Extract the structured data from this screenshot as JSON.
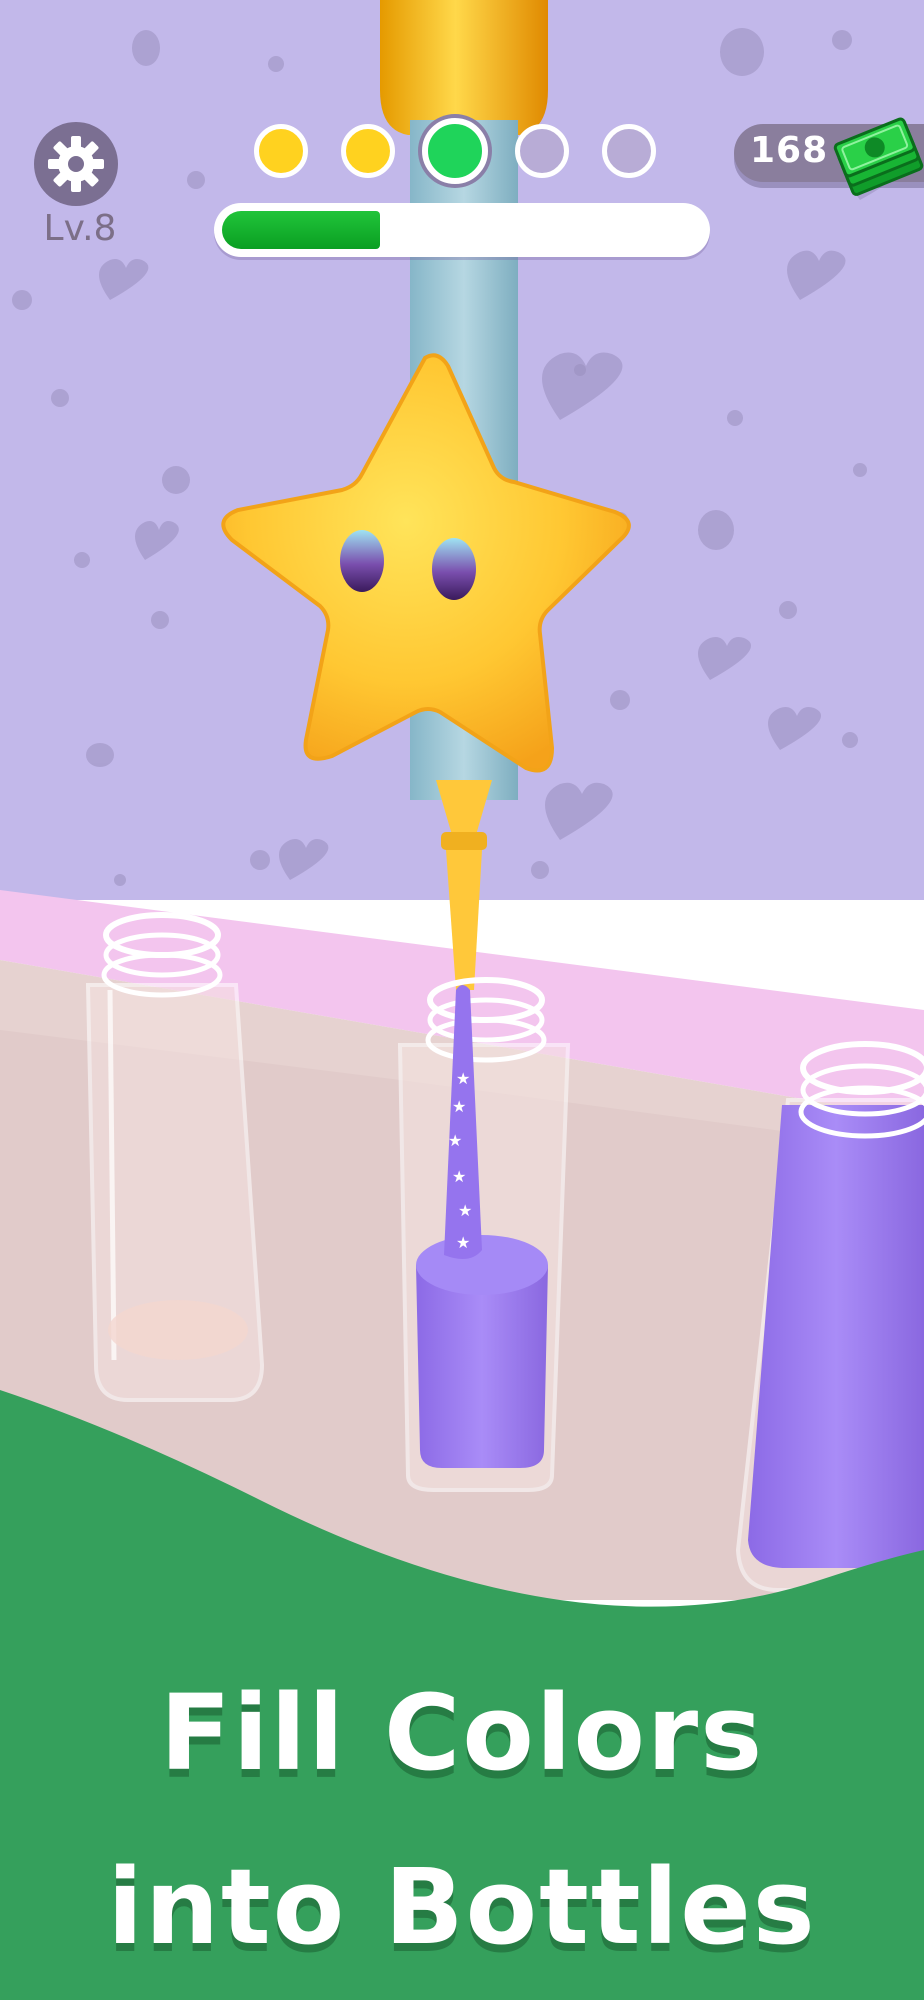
{
  "colors": {
    "wall": "#c2b8ea",
    "wall_spots": "#9a8fbd",
    "shelf_pink": "#f3c5ee",
    "table": "#e6d2d0",
    "hill_green": "#35a05c",
    "sand_purple": "#9a7af0",
    "star_yellow": "#ffc93a",
    "progress_green": "#17b02f",
    "dot_yellow": "#ffd21f",
    "dot_green": "#1fd45a"
  },
  "hud": {
    "settings_icon": "gear-icon",
    "level": "Lv.8",
    "stage_dots": [
      {
        "state": "done",
        "color": "#ffd21f"
      },
      {
        "state": "done",
        "color": "#ffd21f"
      },
      {
        "state": "current",
        "color": "#1fd45a"
      },
      {
        "state": "pending",
        "color": "#b8acd6"
      },
      {
        "state": "pending",
        "color": "#b8acd6"
      }
    ],
    "progress": 0.33,
    "cash": "168",
    "cash_icon": "cash-stack-icon"
  },
  "game": {
    "bottles": [
      {
        "fill": 0.0
      },
      {
        "fill": 0.43
      },
      {
        "fill": 0.9
      }
    ],
    "dispenser": "star-dispenser"
  },
  "caption": {
    "line1": "Fill Colors",
    "line2": "into Bottles"
  }
}
